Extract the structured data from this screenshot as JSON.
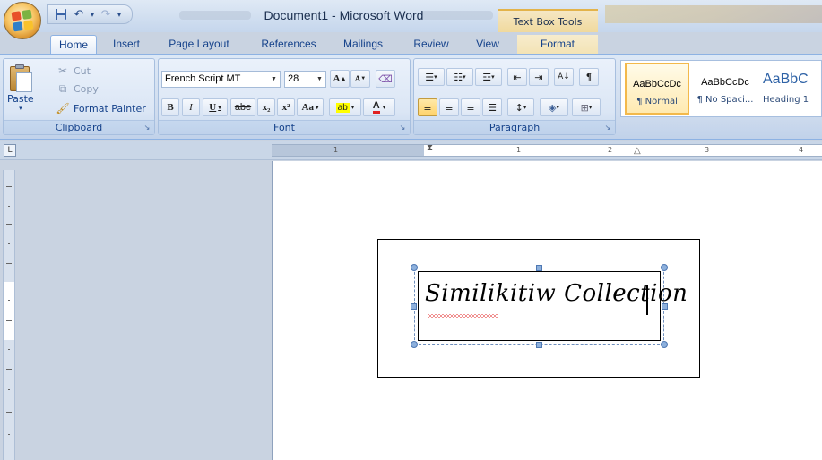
{
  "window": {
    "title": "Document1 - Microsoft Word",
    "contextual_tab_group": "Text Box Tools"
  },
  "quick_access": {
    "save_icon": "save-icon",
    "undo_icon": "undo-icon",
    "redo_icon": "redo-icon"
  },
  "tabs": [
    {
      "label": "Home",
      "active": true
    },
    {
      "label": "Insert"
    },
    {
      "label": "Page Layout"
    },
    {
      "label": "References"
    },
    {
      "label": "Mailings"
    },
    {
      "label": "Review"
    },
    {
      "label": "View"
    },
    {
      "label": "Format",
      "contextual": true
    }
  ],
  "clipboard": {
    "group_label": "Clipboard",
    "paste_label": "Paste",
    "cut_label": "Cut",
    "copy_label": "Copy",
    "format_painter_label": "Format Painter"
  },
  "font": {
    "group_label": "Font",
    "font_name": "French Script MT",
    "font_size": "28",
    "bold": "B",
    "italic": "I",
    "underline": "U",
    "strikethrough": "abe",
    "subscript": "x₂",
    "superscript": "x²",
    "change_case": "Aa",
    "grow_font": "A",
    "shrink_font": "A",
    "highlight": "ab",
    "font_color": "A"
  },
  "paragraph": {
    "group_label": "Paragraph"
  },
  "styles": {
    "items": [
      {
        "sample": "AaBbCcDc",
        "name": "¶ Normal",
        "selected": true
      },
      {
        "sample": "AaBbCcDc",
        "name": "¶ No Spaci..."
      },
      {
        "sample": "AaBbC",
        "name": "Heading 1"
      }
    ]
  },
  "ruler": {
    "marks": [
      "1",
      "1",
      "2",
      "3",
      "4"
    ]
  },
  "document": {
    "text_box_text": "Similikitiw Collection"
  },
  "colors": {
    "ribbon_bg": "#dbe6f5",
    "accent": "#15428b",
    "selected_style": "#f3b94b",
    "spellcheck": "#e02020"
  }
}
